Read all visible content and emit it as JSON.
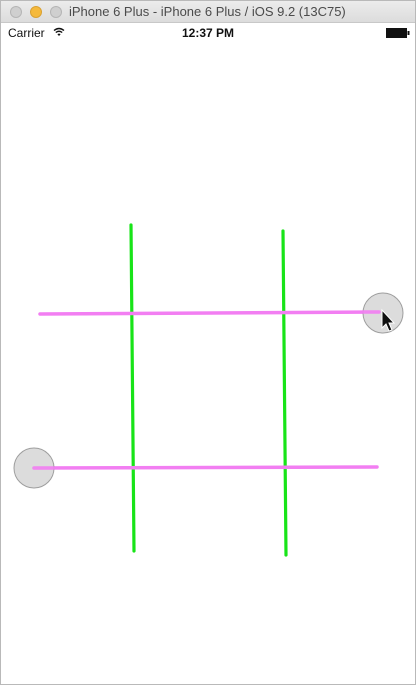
{
  "window": {
    "title": "iPhone 6 Plus - iPhone 6 Plus / iOS 9.2 (13C75)"
  },
  "statusbar": {
    "carrier": "Carrier",
    "time": "12:37 PM",
    "wifi_icon": "wifi-icon",
    "battery_icon": "battery-icon"
  },
  "colors": {
    "vertical_lines": "#18e418",
    "horizontal_lines": "#f27ef2",
    "handle_fill": "#d8d8d8",
    "handle_stroke": "#9e9e9e"
  },
  "board": {
    "vertical_lines_count": 2,
    "horizontal_lines_count": 2,
    "drag_handles_count": 2,
    "cursor_icon": "mouse-pointer-icon"
  }
}
